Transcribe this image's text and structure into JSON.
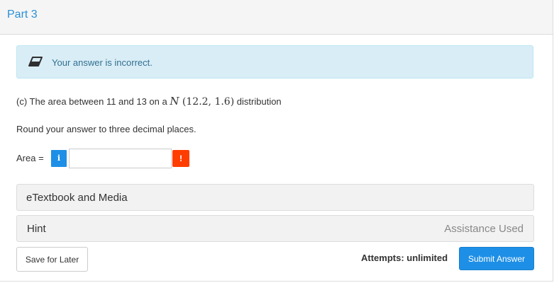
{
  "part": {
    "title": "Part 3"
  },
  "alert": {
    "icon": "eraser-icon",
    "text": "Your answer is incorrect.",
    "color": "#31708f",
    "background": "#d9edf7"
  },
  "question": {
    "prefix": "(c) The area between 11 and 13 on a ",
    "math_n": "N",
    "math_params": " (12.2, 1.6)",
    "suffix": " distribution"
  },
  "instruction": "Round your answer to three decimal places.",
  "answer": {
    "label": "Area =",
    "info_icon": "i",
    "value": "",
    "error_icon": "!",
    "accent": "#1e8fe6",
    "error_color": "#ff3d00"
  },
  "resources": {
    "etextbook_label": "eTextbook and Media",
    "hint_label": "Hint",
    "hint_status": "Assistance Used"
  },
  "footer": {
    "save_label": "Save for Later",
    "attempts_text": "Attempts: unlimited",
    "submit_label": "Submit Answer"
  }
}
